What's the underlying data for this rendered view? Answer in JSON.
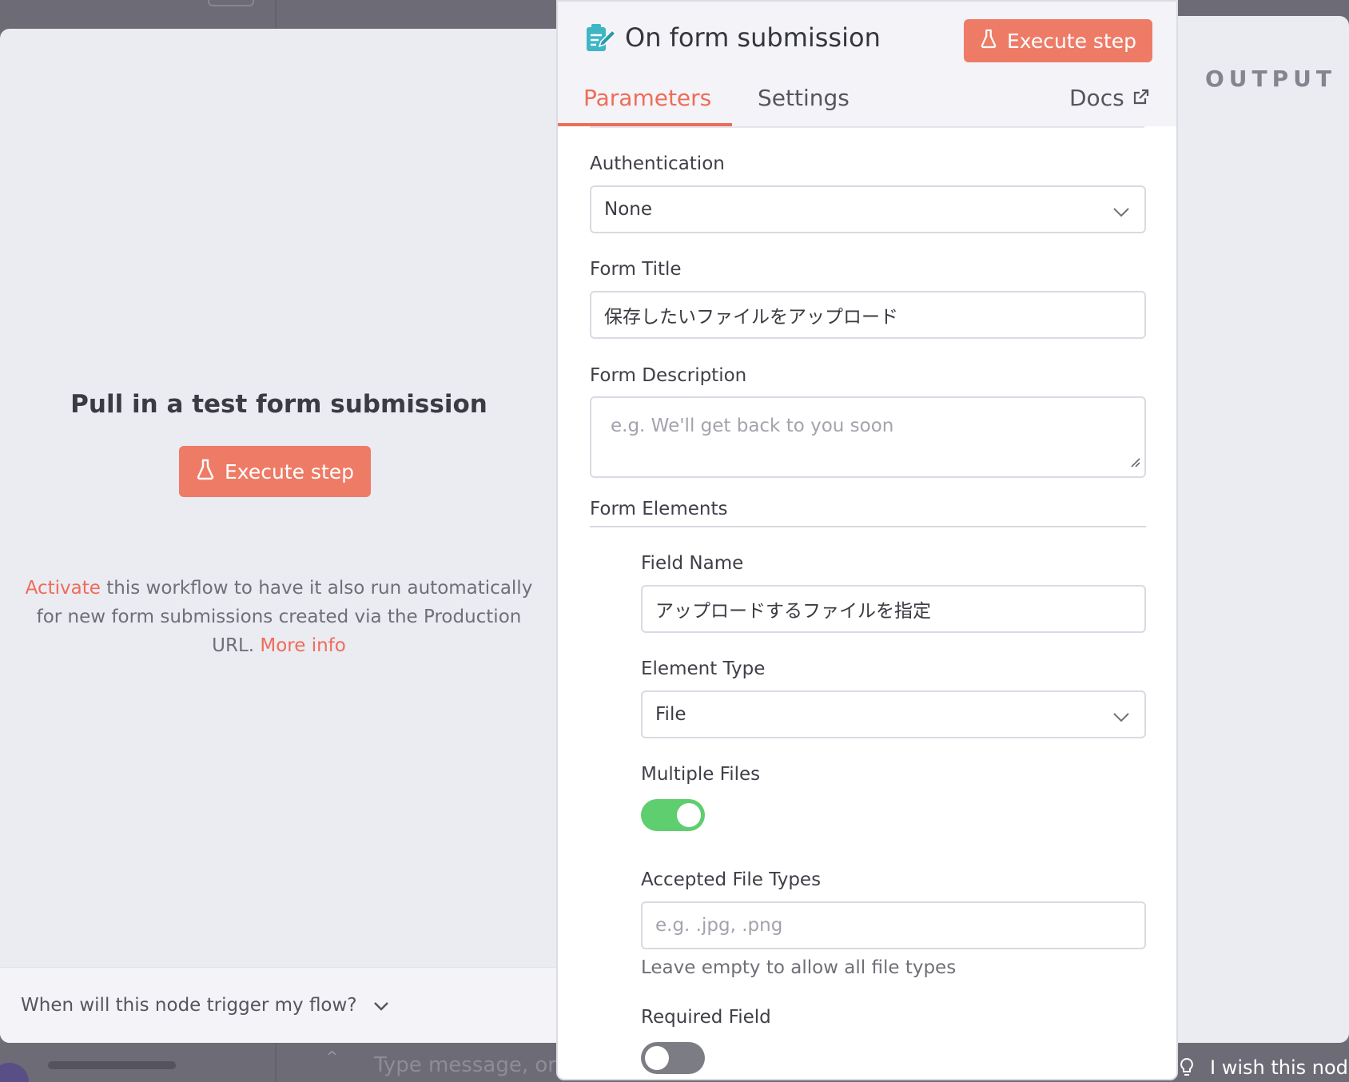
{
  "background": {
    "chat_placeholder": "Type message, or",
    "feedback_text": "I wish this node"
  },
  "input_panel": {
    "title": "Pull in a test form submission",
    "execute_label": "Execute step",
    "activate_link": "Activate",
    "note_text": " this workflow to have it also run automatically for new form submissions created via the Production URL.  ",
    "more_info_link": "More info",
    "footer_question": "When will this node trigger my flow?"
  },
  "output_panel": {
    "label": "OUTPUT"
  },
  "node": {
    "title": "On form submission",
    "execute_label": "Execute step",
    "tabs": [
      {
        "label": "Parameters",
        "active": true
      },
      {
        "label": "Settings",
        "active": false
      }
    ],
    "docs_label": "Docs"
  },
  "parameters": {
    "authentication": {
      "label": "Authentication",
      "value": "None"
    },
    "form_title": {
      "label": "Form Title",
      "value": "保存したいファイルをアップロード"
    },
    "form_description": {
      "label": "Form Description",
      "value": "",
      "placeholder": "e.g. We'll get back to you soon"
    },
    "form_elements": {
      "label": "Form Elements",
      "field_name": {
        "label": "Field Name",
        "value": "アップロードするファイルを指定"
      },
      "element_type": {
        "label": "Element Type",
        "value": "File"
      },
      "multiple_files": {
        "label": "Multiple Files",
        "enabled": true
      },
      "accepted_file_types": {
        "label": "Accepted File Types",
        "value": "",
        "placeholder": "e.g. .jpg, .png",
        "hint": "Leave empty to allow all file types"
      },
      "required_field": {
        "label": "Required Field",
        "enabled": false
      }
    }
  },
  "colors": {
    "accent": "#ee7b66",
    "toggle_on": "#5fce6f",
    "toggle_off": "#7c7c85"
  }
}
